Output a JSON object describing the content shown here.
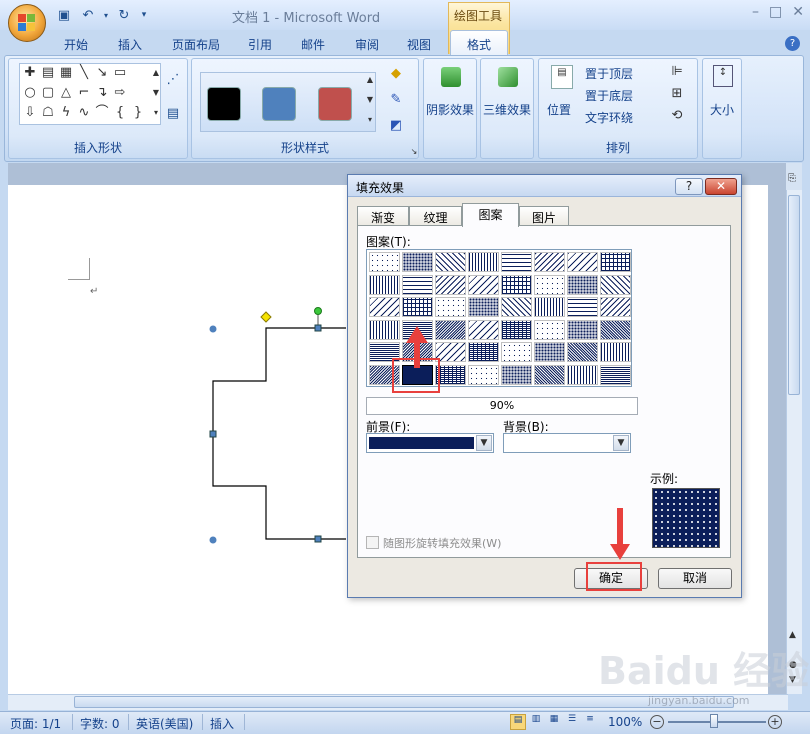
{
  "window": {
    "title": "文档 1 - Microsoft Word",
    "minimize": "–",
    "restore": "□",
    "close": "✕"
  },
  "context_tab_label": "绘图工具",
  "tabs": [
    "开始",
    "插入",
    "页面布局",
    "引用",
    "邮件",
    "审阅",
    "视图",
    "格式"
  ],
  "active_tab": "格式",
  "ribbon": {
    "groups": {
      "insert_shapes": "插入形状",
      "shape_styles": "形状样式",
      "shadow_effects": "阴影效果",
      "threed_effects": "三维效果",
      "arrange": "排列",
      "size": "大小"
    },
    "style_swatch_colors": [
      "#000000",
      "#4f81bd",
      "#c0504d"
    ],
    "arrange_buttons": {
      "position": "位置",
      "bring_to_front": "置于顶层",
      "send_to_back": "置于底层",
      "text_wrapping": "文字环绕"
    }
  },
  "dialog": {
    "title": "填充效果",
    "help": "?",
    "close": "✕",
    "tabs": [
      "渐变",
      "纹理",
      "图案",
      "图片"
    ],
    "active_tab": "图案",
    "pattern_label": "图案(T):",
    "selected_pattern": "90%",
    "foreground_label": "前景(F):",
    "background_label": "背景(B):",
    "foreground_color": "#0b1e5a",
    "sample_label": "示例:",
    "rotate_checkbox": "随图形旋转填充效果(W)",
    "ok": "确定",
    "cancel": "取消"
  },
  "statusbar": {
    "page": "页面: 1/1",
    "words": "字数: 0",
    "language": "英语(美国)",
    "mode": "插入",
    "zoom": "100%"
  },
  "watermark": {
    "logo": "Baidu 经验",
    "url": "jingyan.baidu.com"
  }
}
